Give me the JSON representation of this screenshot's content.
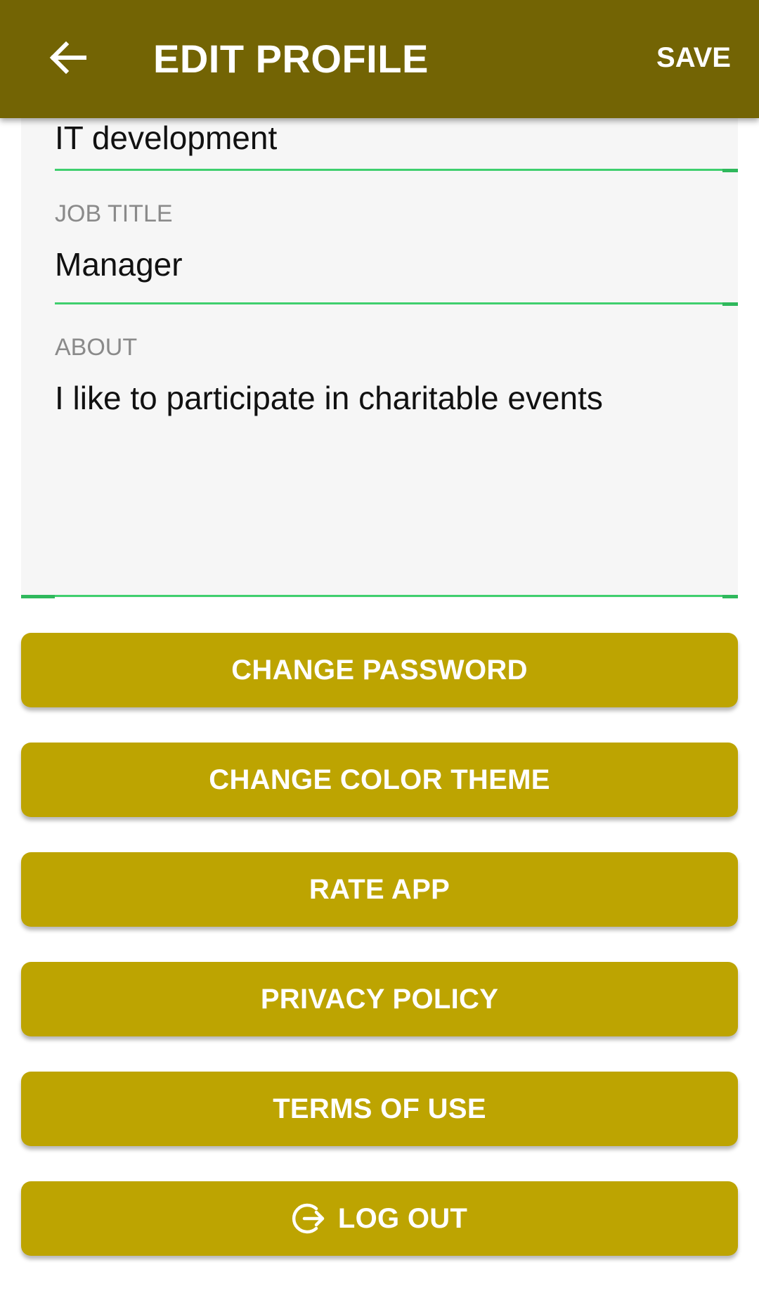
{
  "app_bar": {
    "title": "EDIT PROFILE",
    "save_label": "SAVE",
    "back_icon": "arrow-left-icon",
    "background_color": "#736404"
  },
  "form": {
    "department_value": "IT development",
    "job_title": {
      "label": "JOB TITLE",
      "value": "Manager"
    },
    "about": {
      "label": "ABOUT",
      "value": "I like to participate in charitable events"
    },
    "accent_color": "#3fcf6e"
  },
  "buttons": {
    "change_password": "CHANGE PASSWORD",
    "change_color_theme": "CHANGE COLOR THEME",
    "rate_app": "RATE APP",
    "privacy_policy": "PRIVACY POLICY",
    "terms_of_use": "TERMS OF USE",
    "log_out": "LOG OUT",
    "log_out_icon": "logout-icon",
    "background_color": "#bda401"
  }
}
